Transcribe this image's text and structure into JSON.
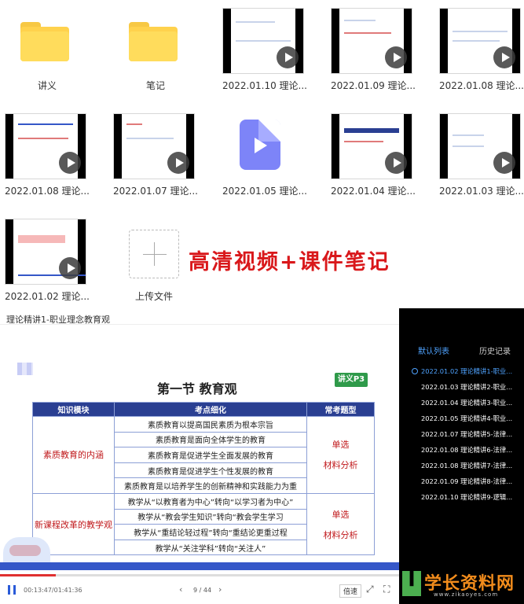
{
  "files": [
    {
      "name": "讲义",
      "type": "folder"
    },
    {
      "name": "笔记",
      "type": "folder"
    },
    {
      "name": "2022.01.10 理论...",
      "type": "video"
    },
    {
      "name": "2022.01.09 理论...",
      "type": "video"
    },
    {
      "name": "2022.01.08 理论...",
      "type": "video"
    },
    {
      "name": "2022.01.08 理论...",
      "type": "video"
    },
    {
      "name": "2022.01.07 理论...",
      "type": "video"
    },
    {
      "name": "2022.01.05 理论...",
      "type": "video-file"
    },
    {
      "name": "2022.01.04 理论...",
      "type": "video"
    },
    {
      "name": "2022.01.03 理论...",
      "type": "video"
    },
    {
      "name": "2022.01.02 理论...",
      "type": "video"
    }
  ],
  "upload_label": "上传文件",
  "promo_text": "高清视频+课件笔记",
  "player": {
    "title": "理论精讲1-职业理念教育观",
    "slide_heading": "第一节  教育观",
    "badge": "讲义P3",
    "table_headers": [
      "知识模块",
      "考点细化",
      "常考题型"
    ],
    "module1": "素质教育的内涵",
    "module1_points": [
      "素质教育以提高国民素质为根本宗旨",
      "素质教育是面向全体学生的教育",
      "素质教育是促进学生全面发展的教育",
      "素质教育是促进学生个性发展的教育",
      "素质教育是以培养学生的创新精神和实践能力为重"
    ],
    "module2": "新课程改革的教学观",
    "module2_points": [
      "教学从“以教育者为中心”转向“以学习者为中心”",
      "教学从“教会学生知识”转向“教会学生学习",
      "教学从“重结论轻过程”转向“重结论更重过程",
      "教学从“关注学科”转向“关注人”"
    ],
    "question_type_1": "单选",
    "question_type_2": "材料分析",
    "time": "00:13:47/01:41:36",
    "progress": 0.14,
    "pages": "9 / 44",
    "speed": "倍速"
  },
  "sidebar": {
    "tab_default": "默认列表",
    "tab_history": "历史记录",
    "items": [
      "2022.01.02 理论精讲1-职业...",
      "2022.01.03 理论精讲2-职业...",
      "2022.01.04 理论精讲3-职业...",
      "2022.01.05 理论精讲4-职业...",
      "2022.01.07 理论精讲5-法律...",
      "2022.01.08 理论精讲6-法律...",
      "2022.01.08 理论精讲7-法律...",
      "2022.01.09 理论精讲8-法律...",
      "2022.01.10 理论精讲9-逻辑..."
    ]
  },
  "watermark": {
    "name": "学长资料网",
    "url": "www.zikaoyes.com"
  },
  "colors": {
    "accent": "#2a3f92",
    "promo": "#d9181b",
    "highlight": "#4fa3ff"
  }
}
